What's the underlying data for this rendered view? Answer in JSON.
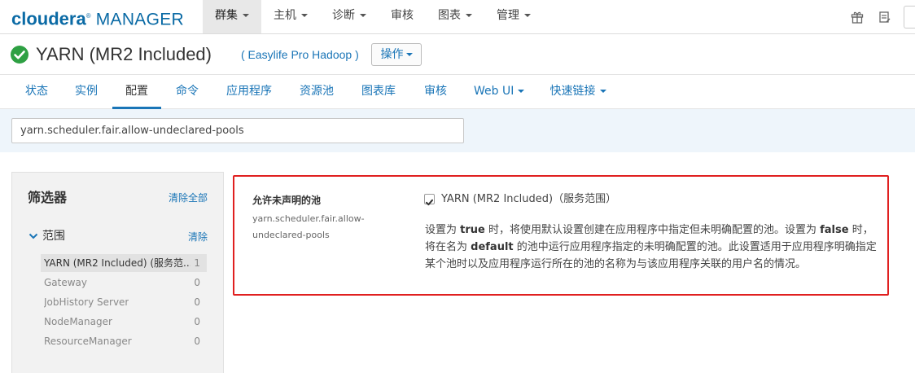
{
  "brand": {
    "part1": "cloudera",
    "part2": "MANAGER",
    "reg": "®"
  },
  "topnav": [
    {
      "label": "群集",
      "active": true
    },
    {
      "label": "主机",
      "active": false
    },
    {
      "label": "诊断",
      "active": false
    },
    {
      "label": "审核",
      "active": false
    },
    {
      "label": "图表",
      "active": false
    },
    {
      "label": "管理",
      "active": false
    }
  ],
  "top_icons": [
    "gift-icon",
    "tasks-icon"
  ],
  "service": {
    "name": "YARN (MR2 Included)",
    "cluster_link": "( Easylife Pro Hadoop )",
    "actions_label": "操作",
    "status_color": "#2ea043"
  },
  "subtabs": [
    {
      "label": "状态"
    },
    {
      "label": "实例"
    },
    {
      "label": "配置",
      "active": true
    },
    {
      "label": "命令"
    },
    {
      "label": "应用程序"
    },
    {
      "label": "资源池"
    },
    {
      "label": "图表库"
    },
    {
      "label": "审核"
    },
    {
      "label": "Web UI",
      "dropdown": true
    },
    {
      "label": "快速链接",
      "dropdown": true
    }
  ],
  "search": {
    "value": "yarn.scheduler.fair.allow-undeclared-pools"
  },
  "filters": {
    "title": "筛选器",
    "clear_all": "清除全部",
    "scope": {
      "label": "范围",
      "clear": "清除",
      "items": [
        {
          "label": "YARN (MR2 Included) (服务范...",
          "count": "1",
          "selected": true
        },
        {
          "label": "Gateway",
          "count": "0"
        },
        {
          "label": "JobHistory Server",
          "count": "0"
        },
        {
          "label": "NodeManager",
          "count": "0"
        },
        {
          "label": "ResourceManager",
          "count": "0"
        }
      ]
    }
  },
  "property": {
    "name": "允许未声明的池",
    "key": "yarn.scheduler.fair.allow-undeclared-pools",
    "checked": true,
    "value": "YARN (MR2 Included)（服务范围）",
    "desc": {
      "p1": "设置为 ",
      "true_kw": "true",
      "p2": " 时，将使用默认设置创建在应用程序中指定但未明确配置的池。设置为 ",
      "false_kw": "false",
      "p3": " 时，将在名为 ",
      "default_kw": "default",
      "p4": " 的池中运行应用程序指定的未明确配置的池。此设置适用于应用程序明确指定某个池时以及应用程序运行所在的池的名称为与该应用程序关联的用户名的情况。"
    }
  },
  "colors": {
    "accent": "#1a75b7",
    "highlight_border": "#e02020"
  }
}
